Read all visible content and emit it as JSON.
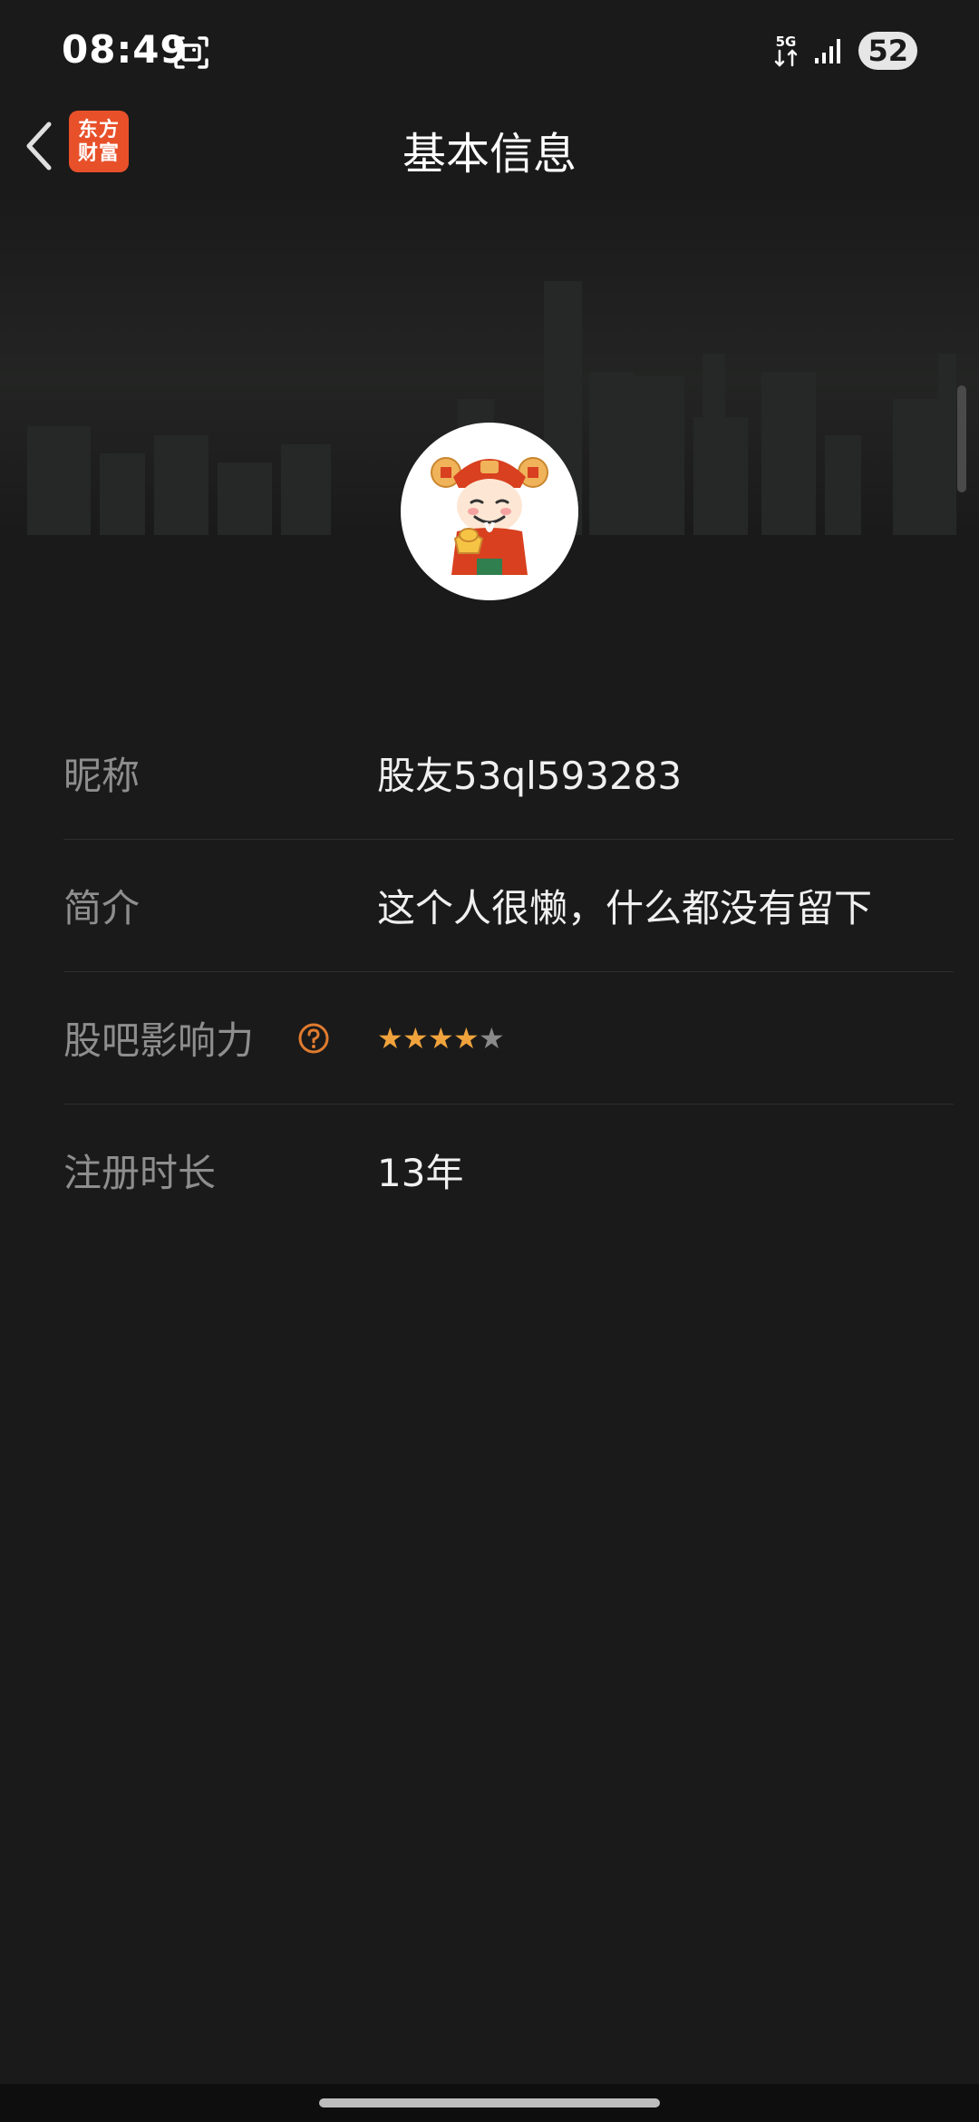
{
  "status_bar": {
    "time": "08:49",
    "network": "5G",
    "battery": "52",
    "screenshot_icon": "screenshot-icon",
    "signal_icon": "signal-bars-icon"
  },
  "header": {
    "title": "基本信息",
    "back_icon": "chevron-left-icon",
    "logo_line1": "东方",
    "logo_line2": "财富"
  },
  "profile": {
    "avatar_icon": "fortune-god-avatar-icon"
  },
  "info": [
    {
      "label": "昵称",
      "value": "股友53ql593283"
    },
    {
      "label": "简介",
      "value": "这个人很懒，什么都没有留下"
    },
    {
      "label": "股吧影响力",
      "rating": 4,
      "rating_max": 5,
      "help_icon": "question-mark-icon"
    },
    {
      "label": "注册时长",
      "value": "13年"
    }
  ],
  "colors": {
    "background": "#1a1a1a",
    "brand_logo": "#e8502a",
    "star_filled": "#f0a33c",
    "star_empty": "#8a8a8a",
    "label_text": "#8e8e8e",
    "value_text": "#f0f0f0"
  }
}
